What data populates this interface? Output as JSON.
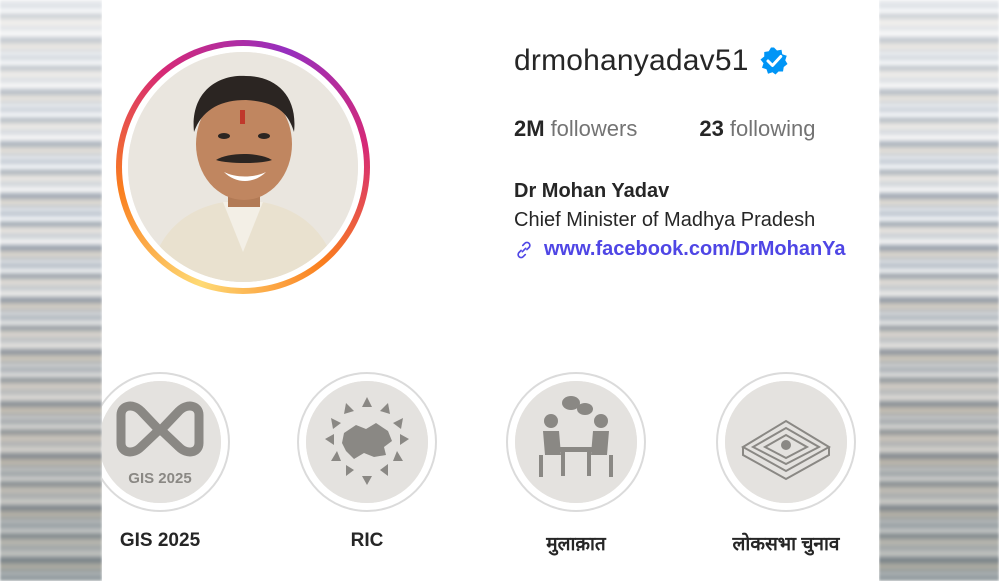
{
  "profile": {
    "username": "drmohanyadav51",
    "followers_count": "2M",
    "followers_label": "followers",
    "following_count": "23",
    "following_label": "following",
    "full_name": "Dr Mohan Yadav",
    "bio": "Chief Minister of Madhya Pradesh",
    "link": "www.facebook.com/DrMohanYa",
    "verified_color": "#0095f6"
  },
  "highlights": [
    {
      "label": "GIS 2025",
      "cover_text": "GIS 2025"
    },
    {
      "label": "RIC"
    },
    {
      "label": "मुलाक़ात"
    },
    {
      "label": "लोकसभा चुनाव"
    }
  ]
}
